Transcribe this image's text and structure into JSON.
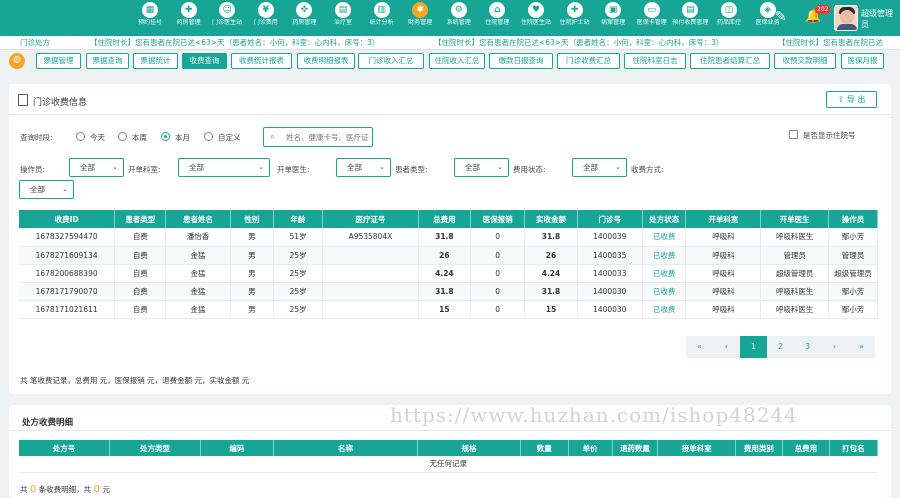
{
  "topnav": {
    "items": [
      {
        "label": "预约挂号",
        "icon": "calendar-icon",
        "glyph": "▦"
      },
      {
        "label": "药房管理",
        "icon": "pill-icon",
        "glyph": "✚"
      },
      {
        "label": "门诊医生站",
        "icon": "doctor-icon",
        "glyph": "☺"
      },
      {
        "label": "门诊费用",
        "icon": "yen-icon",
        "glyph": "¥"
      },
      {
        "label": "药房管理",
        "icon": "pharmacy-icon",
        "glyph": "✜"
      },
      {
        "label": "治疗室",
        "icon": "bed-icon",
        "glyph": "▤"
      },
      {
        "label": "统计分析",
        "icon": "chart-icon",
        "glyph": "▥"
      },
      {
        "label": "财务管理",
        "icon": "gear-icon",
        "glyph": "✱"
      },
      {
        "label": "系统管理",
        "icon": "settings-icon",
        "glyph": "⚙"
      },
      {
        "label": "住院管理",
        "icon": "hospital-icon",
        "glyph": "⌂"
      },
      {
        "label": "住院医生站",
        "icon": "stethoscope-icon",
        "glyph": "♥"
      },
      {
        "label": "住院护士站",
        "icon": "nurse-icon",
        "glyph": "✚"
      },
      {
        "label": "病案管理",
        "icon": "folder-icon",
        "glyph": "▣"
      },
      {
        "label": "医保卡管理",
        "icon": "card-icon",
        "glyph": "▭"
      },
      {
        "label": "预付收费管理",
        "icon": "prepay-icon",
        "glyph": "▤"
      },
      {
        "label": "药品库控",
        "icon": "warehouse-icon",
        "glyph": "◫"
      },
      {
        "label": "医保业务",
        "icon": "insurance-icon",
        "glyph": "◈"
      }
    ],
    "active_index": 7,
    "notification_count": "202",
    "username": "超级管理员"
  },
  "ticker": {
    "items": [
      "门诊处方",
      "【住院时长】您有患者在院已达<63>天（患者姓名：小何，科室：心内科，床号：3）",
      "【住院时长】您有患者在院已达<63>天（患者姓名：小何，科室：心内科，床号：3）",
      "【住院时长】您有患者在院已达"
    ]
  },
  "tabs": [
    "票据管理",
    "票据查询",
    "票据统计",
    "收费查询",
    "收费统计报表",
    "收费明细报表",
    "门诊收入汇总",
    "住院收入汇总",
    "缴款日报查询",
    "门诊收费汇总",
    "住院科室日志",
    "住院患者结算汇总",
    "收预交款明细",
    "医保月报"
  ],
  "active_tab": 3,
  "card1": {
    "title": "门诊收费信息",
    "export_label": "导 出",
    "filters": {
      "time_label": "查询时段:",
      "radios": [
        "今天",
        "本周",
        "本月",
        "自定义"
      ],
      "checked_radio": 2,
      "search_placeholder": "姓名、健康卡号、医疗证号",
      "show_hospitalized_label": "是否显示住院号",
      "operator_label": "操作员:",
      "operator_value": "全部",
      "dept_label": "开单科室:",
      "dept_value": "全部",
      "doctor_label": "开单医生:",
      "doctor_value": "全部",
      "patient_type_label": "患者类型:",
      "patient_type_value": "全部",
      "fee_status_label": "费用状态:",
      "fee_status_value": "全部",
      "pay_method_label": "收费方式:",
      "pay_method_value": "全部"
    },
    "table": {
      "headers": [
        "收费ID",
        "患者类型",
        "患者姓名",
        "性别",
        "年龄",
        "医疗证号",
        "总费用",
        "医保报销",
        "实收金额",
        "门诊号",
        "处方状态",
        "开单科室",
        "开单医生",
        "操作员"
      ],
      "rows": [
        [
          "1678327594470",
          "自费",
          "潘怡香",
          "男",
          "51岁",
          "A9535804X",
          "31.8",
          "0",
          "31.8",
          "1400039",
          "已收费",
          "呼吸科",
          "呼吸科医生",
          "鄢小芳"
        ],
        [
          "1678271609134",
          "自费",
          "金猛",
          "男",
          "25岁",
          "",
          "26",
          "0",
          "26",
          "1400035",
          "已收费",
          "呼吸科",
          "管理员",
          "管理员"
        ],
        [
          "1678200688390",
          "自费",
          "金猛",
          "男",
          "25岁",
          "",
          "4.24",
          "0",
          "4.24",
          "1400033",
          "已收费",
          "呼吸科",
          "超级管理员",
          "超级管理员"
        ],
        [
          "1678171790070",
          "自费",
          "金猛",
          "男",
          "25岁",
          "",
          "31.8",
          "0",
          "31.8",
          "1400030",
          "已收费",
          "呼吸科",
          "呼吸科医生",
          "鄢小芳"
        ],
        [
          "1678171021611",
          "自费",
          "金猛",
          "男",
          "25岁",
          "",
          "15",
          "0",
          "15",
          "1400030",
          "已收费",
          "呼吸科",
          "呼吸科医生",
          "鄢小芳"
        ]
      ]
    },
    "pagination": [
      "«",
      "‹",
      "1",
      "2",
      "3",
      "›",
      "»"
    ],
    "active_page_index": 2,
    "summary": "共  笔收费记录，总费用   元，医保报销   元，退费金额   元，实收金额   元"
  },
  "card2": {
    "title": "处方收费明细",
    "headers": [
      "处方号",
      "处方类型",
      "编码",
      "名称",
      "规格",
      "数量",
      "单价",
      "退药数量",
      "接单科室",
      "费用类别",
      "总费用",
      "打包名"
    ],
    "empty_text": "无任何记录",
    "summary_prefix": "共",
    "count": "0",
    "summary_mid": "条收费明细，共",
    "total": "0",
    "summary_suffix": "元"
  },
  "watermark": "https://www.huzhan.com/ishop48244",
  "colors": {
    "accent": "#17a596",
    "highlight": "#f5a623"
  }
}
